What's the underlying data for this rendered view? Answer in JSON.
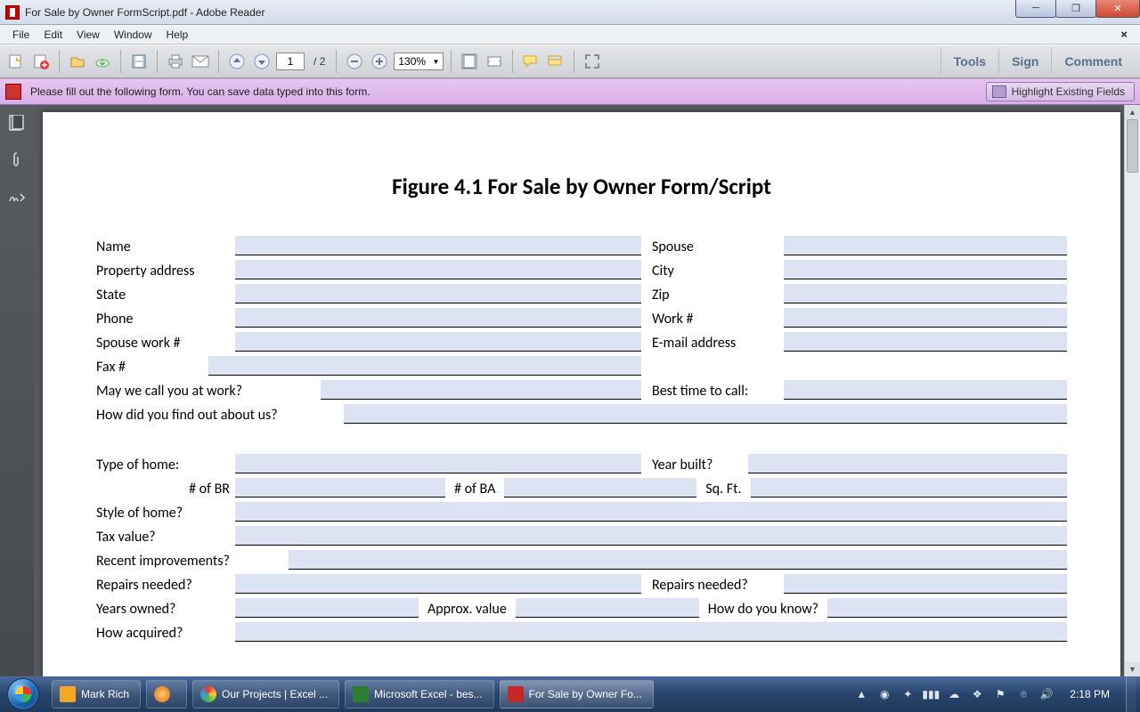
{
  "window": {
    "title": "For Sale by Owner FormScript.pdf - Adobe Reader"
  },
  "menu": {
    "file": "File",
    "edit": "Edit",
    "view": "View",
    "window": "Window",
    "help": "Help"
  },
  "toolbar": {
    "page_current": "1",
    "page_sep": "/",
    "page_total": "2",
    "zoom": "130%",
    "links": {
      "tools": "Tools",
      "sign": "Sign",
      "comment": "Comment"
    }
  },
  "msgbar": {
    "text": "Please fill out the following form. You can save data typed into this form.",
    "highlight_btn": "Highlight Existing Fields"
  },
  "doc": {
    "title": "Figure 4.1 For Sale by Owner Form/Script",
    "labels": {
      "name": "Name",
      "spouse": "Spouse",
      "prop_addr": "Property address",
      "city": "City",
      "state": "State",
      "zip": "Zip",
      "phone": "Phone",
      "work": "Work #",
      "spouse_work": "Spouse work #",
      "email": "E-mail address",
      "fax": "Fax #",
      "call_work": "May we call you at work?",
      "best_time": "Best time to call:",
      "find_out": "How did you find out about us?",
      "type_home": "Type of home:",
      "year_built": "Year built?",
      "br": "# of BR",
      "ba": "# of BA",
      "sqft": "Sq. Ft.",
      "style": "Style of home?",
      "tax": "Tax value?",
      "improve": "Recent improvements?",
      "repairs1": "Repairs needed?",
      "repairs2": "Repairs needed?",
      "years_owned": "Years owned?",
      "approx_value": "Approx. value",
      "how_know": "How do you know?",
      "acquired": "How acquired?"
    }
  },
  "taskbar": {
    "items": [
      {
        "label": "Mark Rich"
      },
      {
        "label": ""
      },
      {
        "label": "Our Projects | Excel ..."
      },
      {
        "label": "Microsoft Excel - bes..."
      },
      {
        "label": "For Sale by Owner Fo..."
      }
    ],
    "clock": "2:18 PM"
  }
}
